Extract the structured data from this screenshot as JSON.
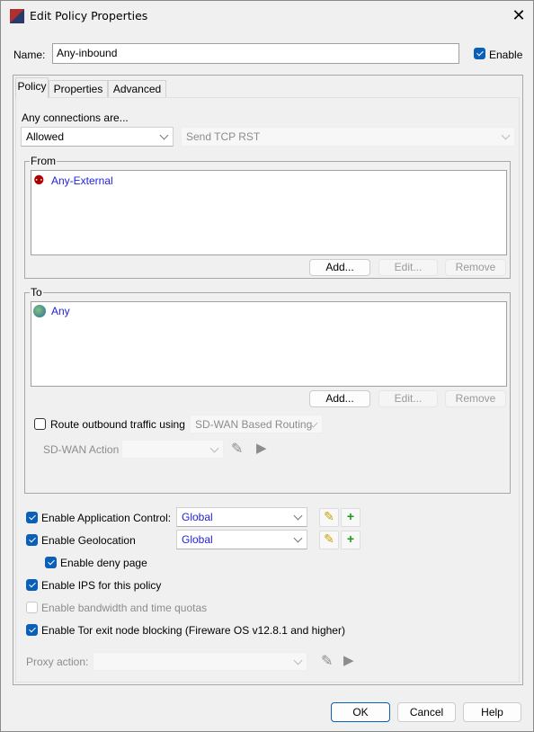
{
  "window": {
    "title": "Edit Policy Properties",
    "close_icon": "close-icon"
  },
  "name": {
    "label": "Name:",
    "value": "Any-inbound"
  },
  "enable": {
    "label": "Enable",
    "checked": true
  },
  "tabs": [
    {
      "label": "Policy",
      "selected": true
    },
    {
      "label": "Properties"
    },
    {
      "label": "Advanced"
    }
  ],
  "connections": {
    "label": "Any connections are...",
    "action": "Allowed",
    "tcp_rst": "Send TCP RST"
  },
  "from": {
    "label": "From",
    "items": [
      "Any-External"
    ],
    "add": "Add...",
    "edit": "Edit...",
    "remove": "Remove"
  },
  "to": {
    "label": "To",
    "items": [
      "Any"
    ],
    "add": "Add...",
    "edit": "Edit...",
    "remove": "Remove"
  },
  "routing": {
    "label": "Route outbound traffic using",
    "checked": false,
    "value": "SD-WAN Based Routing",
    "sdwan_action_label": "SD-WAN Action",
    "sdwan_action_value": ""
  },
  "options": {
    "app_control": {
      "label": "Enable Application Control:",
      "checked": true,
      "value": "Global"
    },
    "geolocation": {
      "label": "Enable Geolocation",
      "checked": true,
      "value": "Global"
    },
    "deny_page": {
      "label": "Enable deny page",
      "checked": true
    },
    "ips": {
      "label": "Enable IPS for this policy",
      "checked": true
    },
    "quotas": {
      "label": "Enable bandwidth and time quotas",
      "checked": false,
      "disabled": true
    },
    "tor": {
      "label": "Enable Tor exit node blocking (Fireware OS v12.8.1 and higher)",
      "checked": true
    }
  },
  "proxy": {
    "label": "Proxy action:",
    "value": ""
  },
  "footer": {
    "ok": "OK",
    "cancel": "Cancel",
    "help": "Help"
  },
  "colors": {
    "accent": "#0a5fb8",
    "link": "#2222dd"
  }
}
